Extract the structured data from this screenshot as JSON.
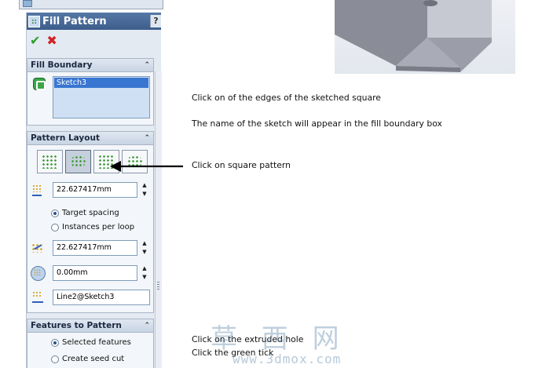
{
  "property_manager": {
    "title": "Fill Pattern",
    "help_label": "?",
    "ok_label": "✔",
    "cancel_label": "✖",
    "fill_boundary": {
      "heading": "Fill Boundary",
      "chevron": "⌃",
      "items": [
        "Sketch3"
      ]
    },
    "pattern_layout": {
      "heading": "Pattern Layout",
      "chevron": "⌃",
      "instance_spacing": "22.627417mm",
      "spacing_options": [
        "Target spacing",
        "Instances per loop"
      ],
      "selected_spacing_option": "Target spacing",
      "loop_spacing": "22.627417mm",
      "boundary_margin": "0.00mm",
      "pattern_direction": "Line2@Sketch3",
      "spin_up": "▲",
      "spin_down": "▼"
    },
    "features_to_pattern": {
      "heading": "Features to Pattern",
      "chevron": "⌃",
      "options": [
        "Selected features",
        "Create seed cut"
      ],
      "selected_option": "Selected features"
    },
    "accent_color": "#3976d1"
  },
  "instructions": [
    "Click on of the edges of the sketched square",
    "The name of the sketch will  appear in the fill boundary box",
    "Click on square pattern",
    "Click on the extruded hole",
    "Click the green tick"
  ],
  "watermark": {
    "text": "草 西 网",
    "url": "www.3dmox.com"
  }
}
